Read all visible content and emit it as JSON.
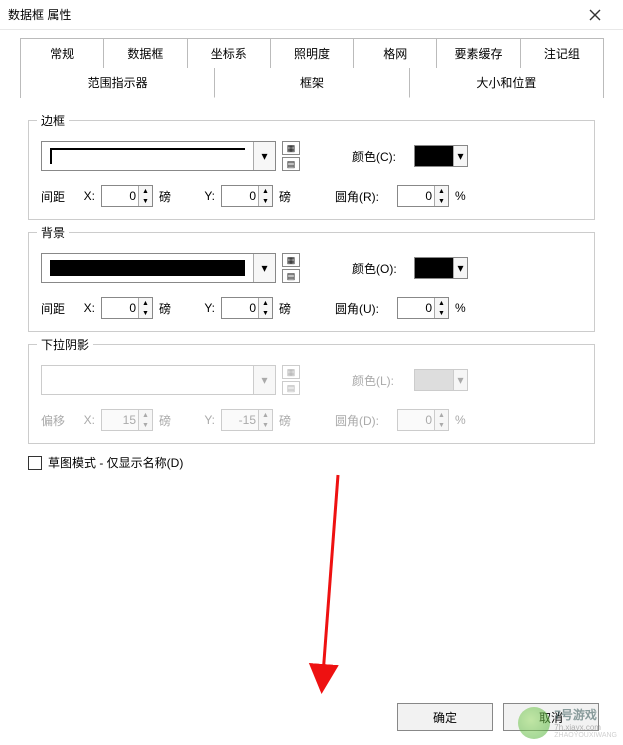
{
  "window": {
    "title": "数据框 属性"
  },
  "tabs_row1": [
    "常规",
    "数据框",
    "坐标系",
    "照明度",
    "格网",
    "要素缓存",
    "注记组"
  ],
  "tabs_row2": [
    "范围指示器",
    "框架",
    "大小和位置"
  ],
  "active_tab": "框架",
  "groups": {
    "border": {
      "title": "边框",
      "color_label": "颜色(C):",
      "gap_label": "间距",
      "x_label": "X:",
      "y_label": "Y:",
      "unit": "磅",
      "round_label": "圆角(R):",
      "pct": "%",
      "x_val": "0",
      "y_val": "0",
      "r_val": "0"
    },
    "background": {
      "title": "背景",
      "color_label": "颜色(O):",
      "gap_label": "间距",
      "x_label": "X:",
      "y_label": "Y:",
      "unit": "磅",
      "round_label": "圆角(U):",
      "pct": "%",
      "x_val": "0",
      "y_val": "0",
      "r_val": "0"
    },
    "shadow": {
      "title": "下拉阴影",
      "color_label": "颜色(L):",
      "offset_label": "偏移",
      "x_label": "X:",
      "y_label": "Y:",
      "unit": "磅",
      "round_label": "圆角(D):",
      "pct": "%",
      "x_val": "15",
      "y_val": "-15",
      "r_val": "0"
    }
  },
  "draft_mode_label": "草图模式 - 仅显示名称(D)",
  "footer": {
    "ok": "确定",
    "cancel": "取消"
  },
  "watermark": {
    "brand": "7号游戏",
    "url": "7h.xiayx.com",
    "sub": "ZHAOYOUXIWANG"
  }
}
